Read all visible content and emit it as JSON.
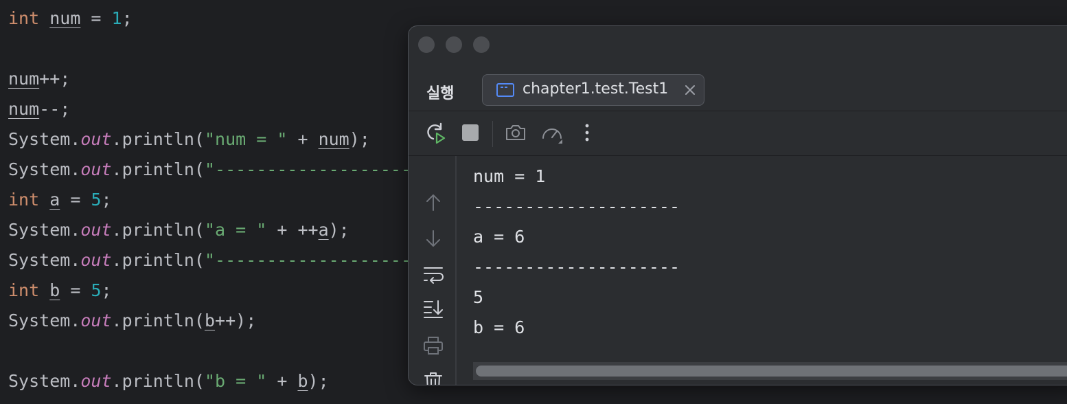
{
  "editor": {
    "lines": [
      [
        {
          "t": "int",
          "c": "kw"
        },
        {
          "t": " ",
          "c": "plain"
        },
        {
          "t": "num",
          "c": "var"
        },
        {
          "t": " = ",
          "c": "plain"
        },
        {
          "t": "1",
          "c": "num"
        },
        {
          "t": ";",
          "c": "plain"
        }
      ],
      [],
      [
        {
          "t": "num",
          "c": "var"
        },
        {
          "t": "++;",
          "c": "plain"
        }
      ],
      [
        {
          "t": "num",
          "c": "var"
        },
        {
          "t": "--;",
          "c": "plain"
        }
      ],
      [
        {
          "t": "System.",
          "c": "plain"
        },
        {
          "t": "out",
          "c": "field"
        },
        {
          "t": ".println(",
          "c": "plain"
        },
        {
          "t": "\"num = \"",
          "c": "str"
        },
        {
          "t": " + ",
          "c": "plain"
        },
        {
          "t": "num",
          "c": "var"
        },
        {
          "t": ");",
          "c": "plain"
        }
      ],
      [
        {
          "t": "System.",
          "c": "plain"
        },
        {
          "t": "out",
          "c": "field"
        },
        {
          "t": ".println(",
          "c": "plain"
        },
        {
          "t": "\"-------------------",
          "c": "str"
        }
      ],
      [
        {
          "t": "int",
          "c": "kw"
        },
        {
          "t": " ",
          "c": "plain"
        },
        {
          "t": "a",
          "c": "var"
        },
        {
          "t": " = ",
          "c": "plain"
        },
        {
          "t": "5",
          "c": "num"
        },
        {
          "t": ";",
          "c": "plain"
        }
      ],
      [
        {
          "t": "System.",
          "c": "plain"
        },
        {
          "t": "out",
          "c": "field"
        },
        {
          "t": ".println(",
          "c": "plain"
        },
        {
          "t": "\"a = \"",
          "c": "str"
        },
        {
          "t": " + ++",
          "c": "plain"
        },
        {
          "t": "a",
          "c": "var"
        },
        {
          "t": ");",
          "c": "plain"
        }
      ],
      [
        {
          "t": "System.",
          "c": "plain"
        },
        {
          "t": "out",
          "c": "field"
        },
        {
          "t": ".println(",
          "c": "plain"
        },
        {
          "t": "\"-------------------",
          "c": "str"
        }
      ],
      [
        {
          "t": "int",
          "c": "kw"
        },
        {
          "t": " ",
          "c": "plain"
        },
        {
          "t": "b",
          "c": "var"
        },
        {
          "t": " = ",
          "c": "plain"
        },
        {
          "t": "5",
          "c": "num"
        },
        {
          "t": ";",
          "c": "plain"
        }
      ],
      [
        {
          "t": "System.",
          "c": "plain"
        },
        {
          "t": "out",
          "c": "field"
        },
        {
          "t": ".println(",
          "c": "plain"
        },
        {
          "t": "b",
          "c": "var"
        },
        {
          "t": "++);",
          "c": "plain"
        }
      ],
      [],
      [
        {
          "t": "System.",
          "c": "plain"
        },
        {
          "t": "out",
          "c": "field"
        },
        {
          "t": ".println(",
          "c": "plain"
        },
        {
          "t": "\"b = \"",
          "c": "str"
        },
        {
          "t": " + ",
          "c": "plain"
        },
        {
          "t": "b",
          "c": "var"
        },
        {
          "t": ");",
          "c": "plain"
        }
      ]
    ]
  },
  "run_window": {
    "tool_title": "실행",
    "tab": {
      "label": "chapter1.test.Test1",
      "icon": "console-window-icon",
      "close_icon": "close-icon"
    },
    "toolbar": {
      "rerun_icon": "rerun-icon",
      "stop_icon": "stop-icon",
      "camera_icon": "camera-icon",
      "profiler_icon": "profiler-gauge-icon",
      "more_icon": "more-vertical-icon"
    },
    "gutter": {
      "up_icon": "arrow-up-icon",
      "down_icon": "arrow-down-icon",
      "wrap_icon": "soft-wrap-icon",
      "scroll_end_icon": "scroll-to-end-icon",
      "print_icon": "print-icon",
      "clear_icon": "trash-icon"
    },
    "output": [
      "num = 1",
      "--------------------",
      "a = 6",
      "--------------------",
      "5",
      "b = 6"
    ]
  },
  "colors": {
    "editor_bg": "#1e1f22",
    "keyword": "#cf8e6d",
    "number": "#2aacb8",
    "string": "#6aab73",
    "field": "#c77dbb",
    "text": "#bcbec4",
    "accent": "#548af7",
    "stop": "#a8aaad",
    "rerun_green": "#5fb865"
  }
}
